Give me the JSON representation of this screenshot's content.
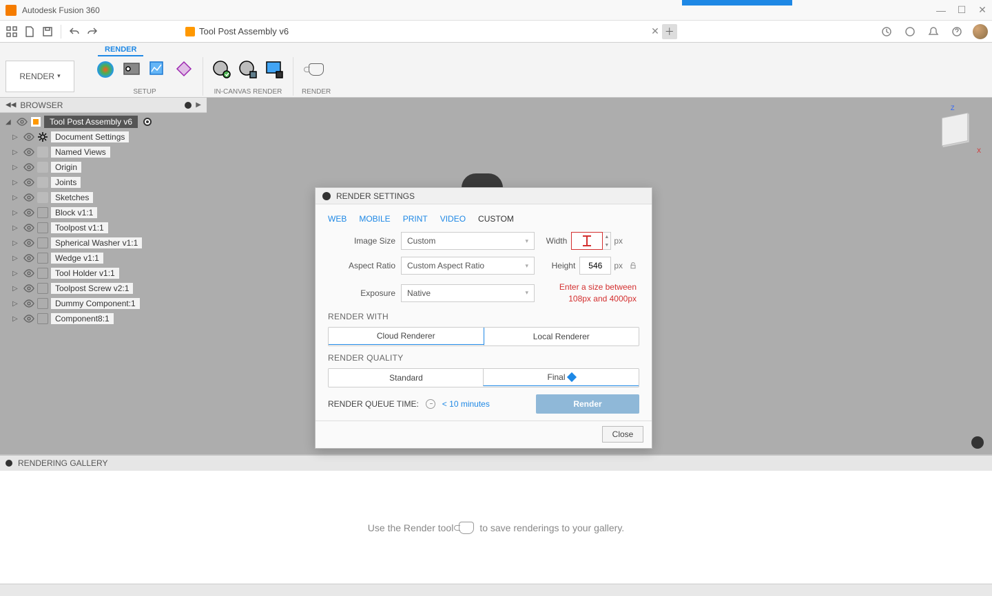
{
  "app": {
    "title": "Autodesk Fusion 360"
  },
  "document": {
    "name": "Tool Post Assembly v6"
  },
  "ribbon": {
    "active_tab": "RENDER",
    "workspace": "RENDER",
    "groups": {
      "setup": "SETUP",
      "in_canvas": "IN-CANVAS RENDER",
      "render": "RENDER"
    }
  },
  "browser": {
    "title": "BROWSER",
    "root": "Tool Post Assembly v6",
    "items": [
      {
        "label": "Document Settings",
        "icon": "gear"
      },
      {
        "label": "Named Views",
        "icon": "folder"
      },
      {
        "label": "Origin",
        "icon": "folder"
      },
      {
        "label": "Joints",
        "icon": "folder"
      },
      {
        "label": "Sketches",
        "icon": "folder"
      },
      {
        "label": "Block v1:1",
        "icon": "comp"
      },
      {
        "label": "Toolpost v1:1",
        "icon": "comp"
      },
      {
        "label": "Spherical Washer v1:1",
        "icon": "comp"
      },
      {
        "label": "Wedge v1:1",
        "icon": "comp"
      },
      {
        "label": "Tool Holder v1:1",
        "icon": "comp"
      },
      {
        "label": "Toolpost Screw v2:1",
        "icon": "comp"
      },
      {
        "label": "Dummy Component:1",
        "icon": "comp"
      },
      {
        "label": "Component8:1",
        "icon": "comp"
      }
    ]
  },
  "dialog": {
    "title": "RENDER SETTINGS",
    "tabs": [
      "WEB",
      "MOBILE",
      "PRINT",
      "VIDEO",
      "CUSTOM"
    ],
    "active_tab": "CUSTOM",
    "fields": {
      "image_size_label": "Image Size",
      "image_size_value": "Custom",
      "aspect_label": "Aspect Ratio",
      "aspect_value": "Custom Aspect Ratio",
      "exposure_label": "Exposure",
      "exposure_value": "Native",
      "width_label": "Width",
      "width_value": "",
      "height_label": "Height",
      "height_value": "546",
      "unit": "px",
      "error_line1": "Enter a size between",
      "error_line2": "108px and 4000px"
    },
    "render_with": {
      "header": "RENDER WITH",
      "cloud": "Cloud Renderer",
      "local": "Local Renderer",
      "selected": "cloud"
    },
    "render_quality": {
      "header": "RENDER QUALITY",
      "standard": "Standard",
      "final": "Final",
      "selected": "final"
    },
    "queue": {
      "label": "RENDER QUEUE TIME:",
      "time": "< 10 minutes"
    },
    "buttons": {
      "render": "Render",
      "close": "Close"
    }
  },
  "gallery": {
    "title": "RENDERING GALLERY",
    "hint_before": "Use the Render tool",
    "hint_after": "to save renderings to your gallery."
  },
  "viewcube": {
    "z": "Z",
    "x": "X"
  }
}
